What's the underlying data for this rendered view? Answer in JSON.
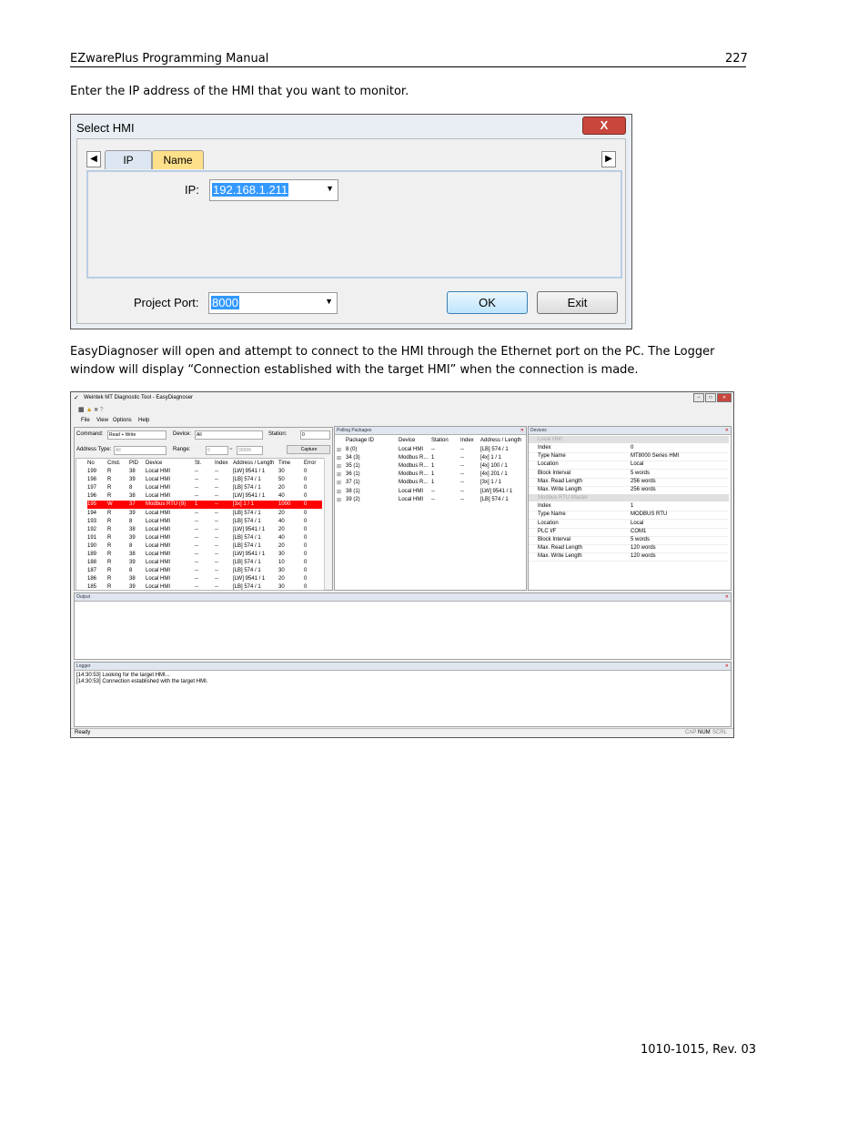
{
  "header": {
    "title": "EZwarePlus Programming Manual",
    "page_number": "227"
  },
  "intro_text": "Enter the IP address of the HMI that you want to monitor.",
  "dialog": {
    "title": "Select HMI",
    "close_label": "X",
    "tabs": [
      {
        "label": "IP"
      },
      {
        "label": "Name"
      }
    ],
    "ip_label": "IP:",
    "ip_value": "192.168.1.211",
    "project_port_label": "Project Port:",
    "project_port_value": "8000",
    "ok_label": "OK",
    "exit_label": "Exit",
    "colors": {
      "active_tab": "#dde7f3",
      "name_tab": "#ffe08a",
      "selection": "#3399ff",
      "close": "#c9463d"
    }
  },
  "body_text": "EasyDiagnoser will open and attempt to connect to the HMI through the Ethernet port on the PC. The Logger window will display “Connection established with the target HMI” when the connection is made.",
  "app": {
    "title": "Weintek MT Diagnostic Tool - EasyDiagnoser",
    "menu": [
      "File",
      "View",
      "Options",
      "Help"
    ],
    "filters": {
      "command_label": "Command:",
      "command_value": "Read + Write",
      "device_label": "Device:",
      "device_value": "All",
      "station_label": "Station:",
      "station_value": "0",
      "address_type_label": "Address Type:",
      "address_type_value": "All",
      "range_label": "Range:",
      "range_from": "0",
      "range_sep": "~",
      "range_to": "99999",
      "capture_label": "Capture"
    },
    "packet_table": {
      "columns": [
        "No",
        "Cmd.",
        "PID",
        "Device",
        "St.",
        "Index",
        "Address / Length",
        "Time",
        "Error"
      ],
      "rows": [
        [
          "199",
          "R",
          "38",
          "Local HMI",
          "--",
          "--",
          "[LW] 9541 / 1",
          "30",
          "0"
        ],
        [
          "198",
          "R",
          "39",
          "Local HMI",
          "--",
          "--",
          "[LB] 574 / 1",
          "50",
          "0"
        ],
        [
          "197",
          "R",
          "8",
          "Local HMI",
          "--",
          "--",
          "[LB] 574 / 1",
          "20",
          "0"
        ],
        [
          "196",
          "R",
          "38",
          "Local HMI",
          "--",
          "--",
          "[LW] 9541 / 1",
          "40",
          "0"
        ],
        [
          "195",
          "W",
          "37",
          "Modbus RTU (9)",
          "1",
          "--",
          "[3x] 1 / 1",
          "1000",
          "0"
        ],
        [
          "194",
          "R",
          "39",
          "Local HMI",
          "--",
          "--",
          "[LB] 574 / 1",
          "20",
          "0"
        ],
        [
          "193",
          "R",
          "8",
          "Local HMI",
          "--",
          "--",
          "[LB] 574 / 1",
          "40",
          "0"
        ],
        [
          "192",
          "R",
          "38",
          "Local HMI",
          "--",
          "--",
          "[LW] 9541 / 1",
          "20",
          "0"
        ],
        [
          "191",
          "R",
          "39",
          "Local HMI",
          "--",
          "--",
          "[LB] 574 / 1",
          "40",
          "0"
        ],
        [
          "190",
          "R",
          "8",
          "Local HMI",
          "--",
          "--",
          "[LB] 574 / 1",
          "20",
          "0"
        ],
        [
          "189",
          "R",
          "38",
          "Local HMI",
          "--",
          "--",
          "[LW] 9541 / 1",
          "30",
          "0"
        ],
        [
          "188",
          "R",
          "39",
          "Local HMI",
          "--",
          "--",
          "[LB] 574 / 1",
          "10",
          "0"
        ],
        [
          "187",
          "R",
          "8",
          "Local HMI",
          "--",
          "--",
          "[LB] 574 / 1",
          "30",
          "0"
        ],
        [
          "186",
          "R",
          "38",
          "Local HMI",
          "--",
          "--",
          "[LW] 9541 / 1",
          "20",
          "0"
        ],
        [
          "185",
          "R",
          "39",
          "Local HMI",
          "--",
          "--",
          "[LB] 574 / 1",
          "30",
          "0"
        ]
      ],
      "selected_index": 4
    },
    "polling": {
      "title": "Polling Packages",
      "columns": [
        "Package ID",
        "Device",
        "Station",
        "Index",
        "Address / Length"
      ],
      "rows": [
        [
          "8 (0)",
          "Local HMI",
          "--",
          "--",
          "[LB] 574 / 1"
        ],
        [
          "34 (3)",
          "Modbus R...",
          "1",
          "--",
          "[4x] 1 / 1"
        ],
        [
          "35 (1)",
          "Modbus R...",
          "1",
          "--",
          "[4x] 100 / 1"
        ],
        [
          "36 (1)",
          "Modbus R...",
          "1",
          "--",
          "[4x] 201 / 1"
        ],
        [
          "37 (1)",
          "Modbus R...",
          "1",
          "--",
          "[3x] 1 / 1"
        ],
        [
          "38 (1)",
          "Local HMI",
          "--",
          "--",
          "[LW] 9541 / 1"
        ],
        [
          "39 (2)",
          "Local HMI",
          "--",
          "--",
          "[LB] 574 / 1"
        ]
      ]
    },
    "devices": {
      "title": "Devices",
      "groups": [
        {
          "name": "Local HMI",
          "props": [
            [
              "Index",
              "0"
            ],
            [
              "Type Name",
              "MT8000 Series HMI"
            ],
            [
              "Location",
              "Local"
            ],
            [
              "Block Interval",
              "5 words"
            ],
            [
              "Max. Read Length",
              "256 words"
            ],
            [
              "Max. Write Length",
              "256 words"
            ]
          ]
        },
        {
          "name": "Modbus RTU Master",
          "props": [
            [
              "Index",
              "1"
            ],
            [
              "Type Name",
              "MODBUS RTU"
            ],
            [
              "Location",
              "Local"
            ],
            [
              "PLC I/F",
              "COM1"
            ],
            [
              "Block Interval",
              "5 words"
            ],
            [
              "Max. Read Length",
              "120 words"
            ],
            [
              "Max. Write Length",
              "120 words"
            ]
          ]
        }
      ]
    },
    "output": {
      "title": "Output"
    },
    "logger": {
      "title": "Logger",
      "lines": [
        "[14:30:53] Looking for the target HMI...",
        "[14:30:53] Connection established with the target HMI."
      ]
    },
    "status": {
      "left": "Ready",
      "caps": "CAP",
      "num": "NUM",
      "scrl": "SCRL"
    }
  },
  "footer": {
    "doc_id": "1010-1015, Rev. 03"
  }
}
